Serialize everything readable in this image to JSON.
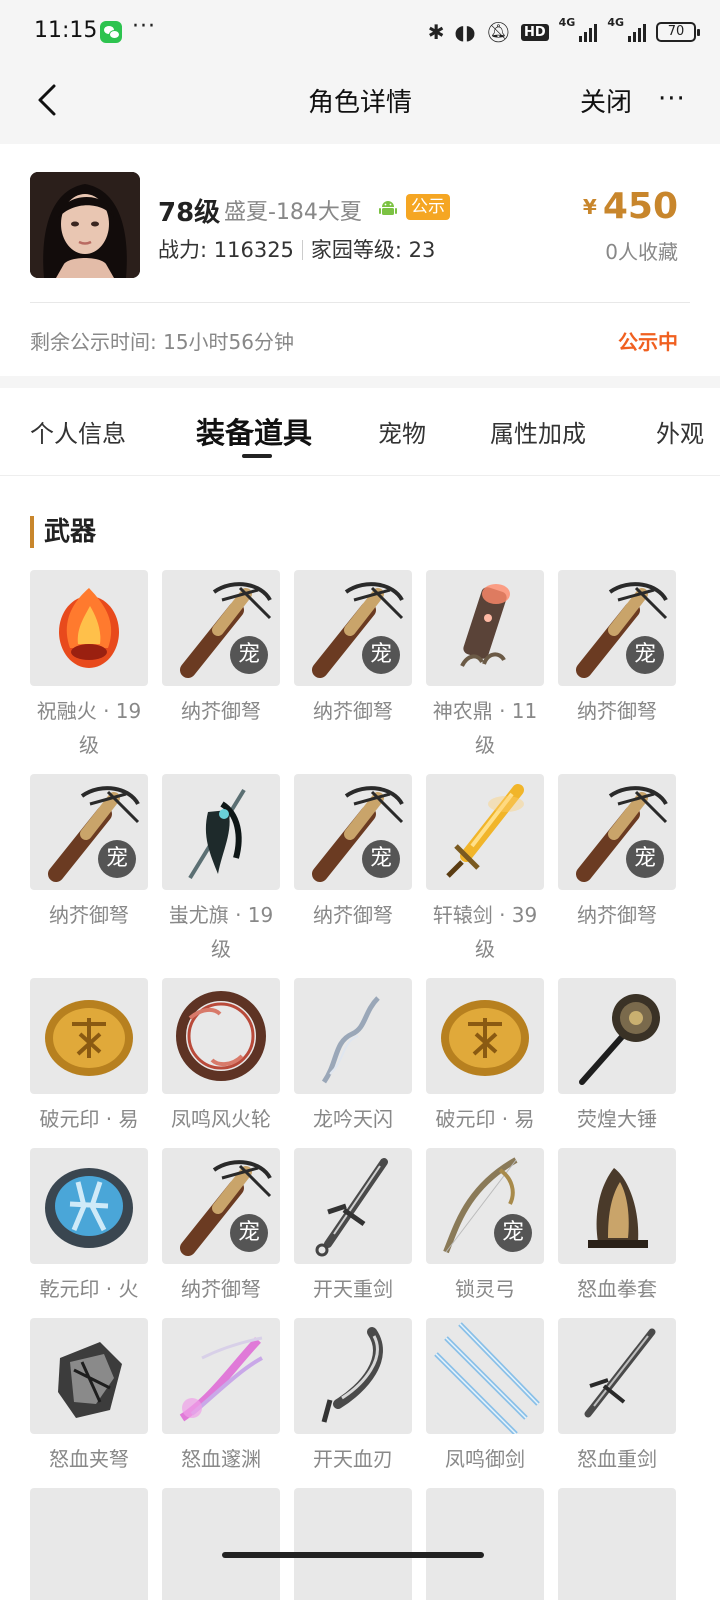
{
  "status_bar": {
    "time": "11:15",
    "battery": "70",
    "network_1": "4G",
    "network_2": "4G",
    "hd_label": "HD",
    "dots": "···"
  },
  "nav": {
    "title": "角色详情",
    "close_label": "关闭",
    "more_label": "···"
  },
  "profile": {
    "level": "78级",
    "server": "盛夏-184大夏",
    "badge": "公示",
    "power_label": "战力: 116325",
    "home_label": "家园等级: 23",
    "currency": "¥",
    "price": "450",
    "favorites": "0人收藏",
    "remaining": "剩余公示时间: 15小时56分钟",
    "status": "公示中"
  },
  "tabs": [
    {
      "label": "个人信息"
    },
    {
      "label": "装备道具"
    },
    {
      "label": "宠物"
    },
    {
      "label": "属性加成"
    },
    {
      "label": "外观"
    }
  ],
  "section": {
    "title": "武器"
  },
  "items": [
    {
      "name": "祝融火 · 19级",
      "pet": ""
    },
    {
      "name": "纳芥御弩",
      "pet": "宠"
    },
    {
      "name": "纳芥御弩",
      "pet": "宠"
    },
    {
      "name": "神农鼎 · 11级",
      "pet": ""
    },
    {
      "name": "纳芥御弩",
      "pet": "宠"
    },
    {
      "name": "纳芥御弩",
      "pet": "宠"
    },
    {
      "name": "蚩尤旗 · 19级",
      "pet": ""
    },
    {
      "name": "纳芥御弩",
      "pet": "宠"
    },
    {
      "name": "轩辕剑 · 39级",
      "pet": ""
    },
    {
      "name": "纳芥御弩",
      "pet": "宠"
    },
    {
      "name": "破元印 · 易",
      "pet": ""
    },
    {
      "name": "凤鸣风火轮",
      "pet": ""
    },
    {
      "name": "龙吟天闪",
      "pet": ""
    },
    {
      "name": "破元印 · 易",
      "pet": ""
    },
    {
      "name": "荧煌大锤",
      "pet": ""
    },
    {
      "name": "乾元印 · 火",
      "pet": ""
    },
    {
      "name": "纳芥御弩",
      "pet": "宠"
    },
    {
      "name": "开天重剑",
      "pet": ""
    },
    {
      "name": "锁灵弓",
      "pet": "宠"
    },
    {
      "name": "怒血拳套",
      "pet": ""
    },
    {
      "name": "怒血夹弩",
      "pet": ""
    },
    {
      "name": "怒血邃渊",
      "pet": ""
    },
    {
      "name": "开天血刃",
      "pet": ""
    },
    {
      "name": "凤鸣御剑",
      "pet": ""
    },
    {
      "name": "怒血重剑",
      "pet": ""
    }
  ],
  "colors": {
    "accent": "#c8862c",
    "status": "#f06020",
    "badge": "#f5a623",
    "android": "#7cc243"
  }
}
